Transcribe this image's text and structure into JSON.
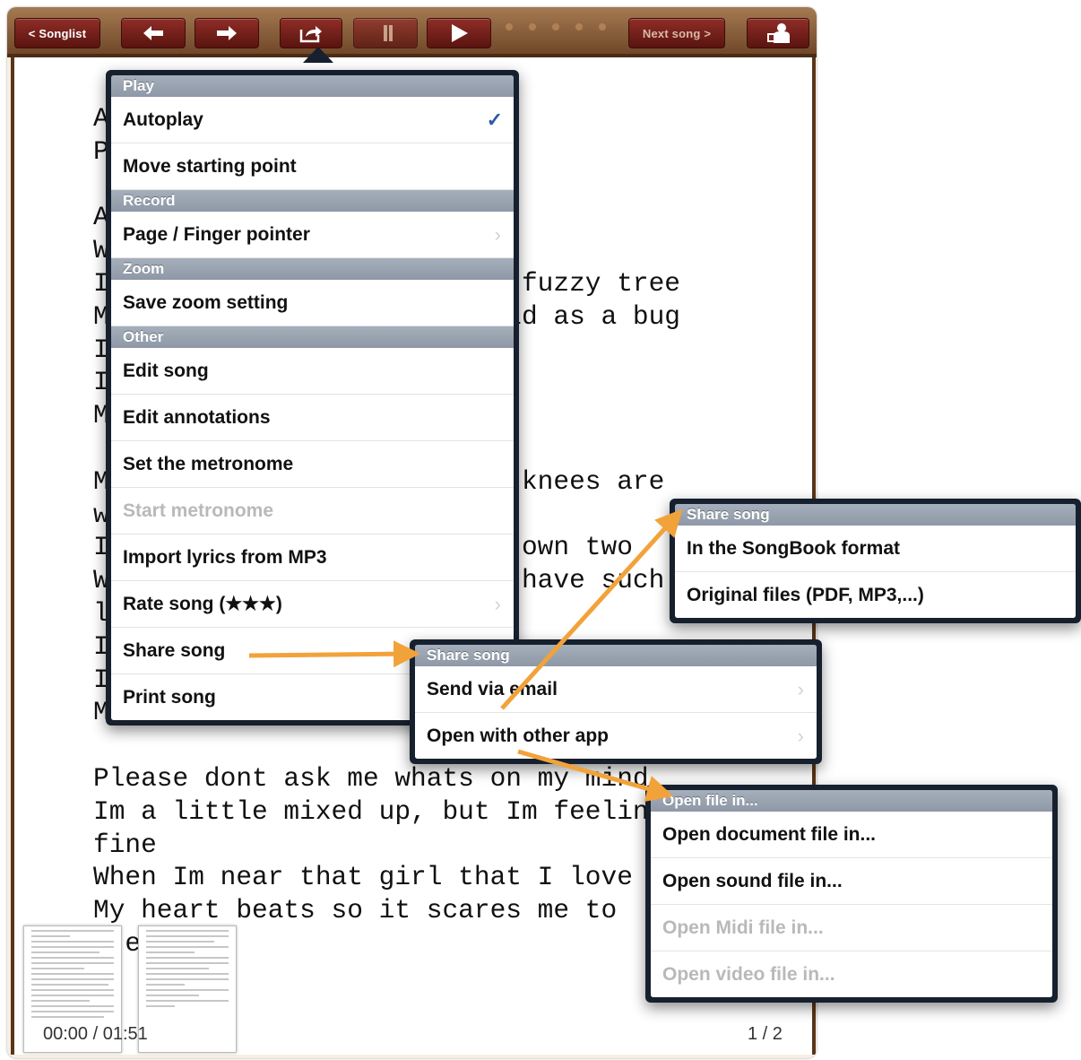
{
  "toolbar": {
    "songlist_label": "< Songlist",
    "back_icon": "left-arrow-icon",
    "forward_icon": "right-arrow-icon",
    "share_icon": "share-icon",
    "play_icon": "play-icon",
    "next_song_label": "Next song >",
    "people_icon": "band-icon"
  },
  "lyrics": {
    "lines": [
      "A",
      "P",
      "",
      "A",
      "W",
      "I                          fuzzy tree",
      "M                         ld as a bug",
      "I",
      "I",
      "M",
      "",
      "M                          knees are",
      "w",
      "I                          own two",
      "W                          have such",
      "l",
      "I",
      "I",
      "M",
      "",
      "Please dont ask me whats on my mind",
      "Im a little mixed up, but Im feelin",
      "fine",
      "When Im near that girl that I love",
      "My heart beats so it scares me to",
      "  ea"
    ]
  },
  "footer": {
    "time": "00:00 / 01:51",
    "page": "1 / 2"
  },
  "menu": {
    "sections": [
      {
        "title": "Play",
        "items": [
          {
            "label": "Autoplay",
            "checked": true
          },
          {
            "label": "Move starting point"
          }
        ]
      },
      {
        "title": "Record",
        "items": [
          {
            "label": "Page / Finger pointer",
            "chevron": true
          }
        ]
      },
      {
        "title": "Zoom",
        "items": [
          {
            "label": "Save zoom setting"
          }
        ]
      },
      {
        "title": "Other",
        "items": [
          {
            "label": "Edit song"
          },
          {
            "label": "Edit annotations"
          },
          {
            "label": "Set the metronome"
          },
          {
            "label": "Start metronome",
            "disabled": true
          },
          {
            "label": "Import lyrics from MP3"
          },
          {
            "label": "Rate song (★★★)",
            "chevron": true
          },
          {
            "label": "Share song"
          },
          {
            "label": "Print song"
          }
        ]
      }
    ]
  },
  "share_menu": {
    "title": "Share song",
    "items": [
      {
        "label": "Send via email"
      },
      {
        "label": "Open with other app"
      }
    ]
  },
  "share_format_menu": {
    "title": "Share song",
    "items": [
      {
        "label": "In the SongBook format"
      },
      {
        "label": "Original files (PDF, MP3,...)"
      }
    ]
  },
  "open_menu": {
    "title": "Open file in...",
    "items": [
      {
        "label": "Open document file in..."
      },
      {
        "label": "Open sound file in..."
      },
      {
        "label": "Open Midi file in...",
        "disabled": true
      },
      {
        "label": "Open video file in...",
        "disabled": true
      }
    ]
  },
  "colors": {
    "arrow": "#f2a23a",
    "popover_border": "#16202e",
    "toolbar_button": "#7a221c"
  }
}
